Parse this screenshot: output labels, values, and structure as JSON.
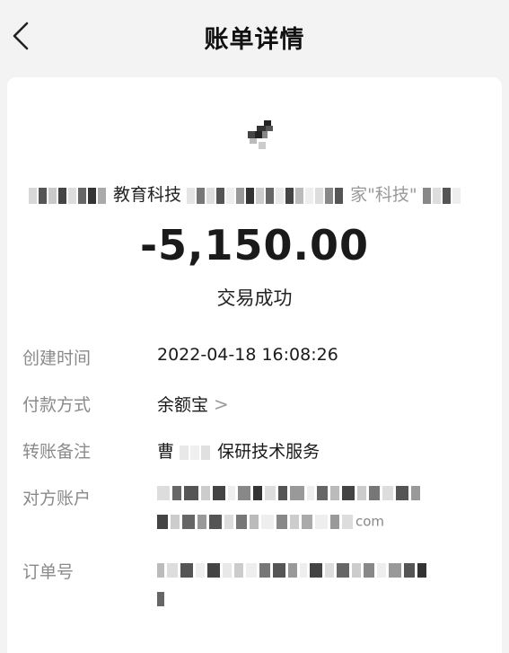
{
  "header": {
    "title": "账单详情",
    "back_icon": "chevron-left-icon"
  },
  "merchant": {
    "name_visible_part": "教育科技",
    "name_visible_part_2": "家\"科技\"",
    "logo_icon": "merchant-logo-icon"
  },
  "transaction": {
    "amount": "-5,150.00",
    "status": "交易成功"
  },
  "details": {
    "created_time_label": "创建时间",
    "created_time_value": "2022-04-18 16:08:26",
    "payment_method_label": "付款方式",
    "payment_method_value": "余额宝",
    "payment_method_chevron": ">",
    "memo_label": "转账备注",
    "memo_prefix": "曹",
    "memo_value": "保研技术服务",
    "counterparty_label": "对方账户",
    "counterparty_suffix": "com",
    "order_label": "订单号"
  },
  "colors": {
    "background": "#f3f3f3",
    "card": "#ffffff",
    "label": "#8a8a8a",
    "text": "#1a1a1a"
  }
}
